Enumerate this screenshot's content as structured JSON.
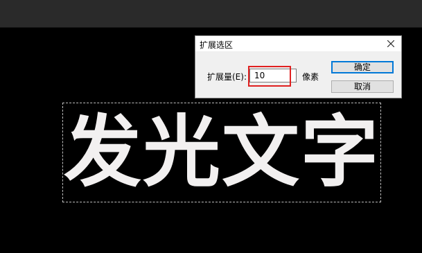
{
  "canvas": {
    "glow_text": "发光文字"
  },
  "dialog": {
    "title": "扩展选区",
    "close_icon": "close-icon",
    "expand_label": "扩展量(E):",
    "expand_value": "10",
    "unit": "像素",
    "ok_label": "确定",
    "cancel_label": "取消"
  },
  "colors": {
    "highlight_box": "#e02020",
    "focus_border": "#0078d7"
  }
}
